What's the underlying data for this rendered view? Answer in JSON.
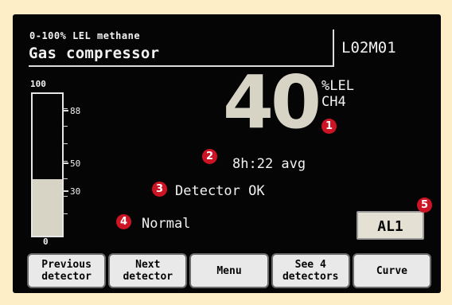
{
  "header": {
    "gas_range": "0-100% LEL methane",
    "location": "Gas compressor",
    "detector_code": "L02M01"
  },
  "bar_graph": {
    "max_label": "100",
    "min_label": "0",
    "level_percent": 40,
    "ticks": [
      {
        "label": "88"
      },
      {
        "label": "50"
      },
      {
        "label": "30"
      }
    ]
  },
  "reading": {
    "value": "40",
    "unit": "%LEL",
    "gas": "CH4"
  },
  "average": "8h:22 avg",
  "detector_status": "Detector OK",
  "mode": "Normal",
  "alarm": "AL1",
  "callouts": [
    "1",
    "2",
    "3",
    "4",
    "5"
  ],
  "softkeys": [
    {
      "line1": "Previous",
      "line2": "detector"
    },
    {
      "line1": "Next",
      "line2": "detector"
    },
    {
      "line1": "Menu",
      "line2": ""
    },
    {
      "line1": "See 4",
      "line2": "detectors"
    },
    {
      "line1": "Curve",
      "line2": ""
    }
  ],
  "colors": {
    "background": "#fdeec7",
    "screen": "#050505",
    "reading": "#d8d4c5",
    "callout": "#cc1425"
  }
}
